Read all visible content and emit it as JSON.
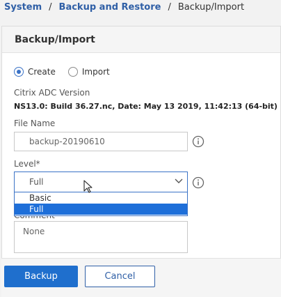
{
  "breadcrumb": {
    "items": [
      "System",
      "Backup and Restore",
      "Backup/Import"
    ],
    "separator": "/"
  },
  "panel": {
    "title": "Backup/Import"
  },
  "mode": {
    "options": [
      {
        "label": "Create",
        "checked": true
      },
      {
        "label": "Import",
        "checked": false
      }
    ]
  },
  "version": {
    "label": "Citrix ADC Version",
    "value": "NS13.0: Build 36.27.nc, Date: May 13 2019, 11:42:13  (64-bit)"
  },
  "file_name": {
    "label": "File Name",
    "value": "backup-20190610"
  },
  "level": {
    "label": "Level*",
    "selected": "Full",
    "options": [
      "Basic",
      "Full"
    ]
  },
  "comment": {
    "label": "Comment",
    "value": "None"
  },
  "actions": {
    "backup_label": "Backup",
    "cancel_label": "Cancel"
  },
  "colors": {
    "accent": "#1f6fcd",
    "link": "#2f5fa6",
    "selected_option": "#1e6fd9"
  },
  "icons": {
    "info": "info-circle-icon",
    "chevron": "chevron-down-icon",
    "cursor": "mouse-pointer-icon"
  }
}
